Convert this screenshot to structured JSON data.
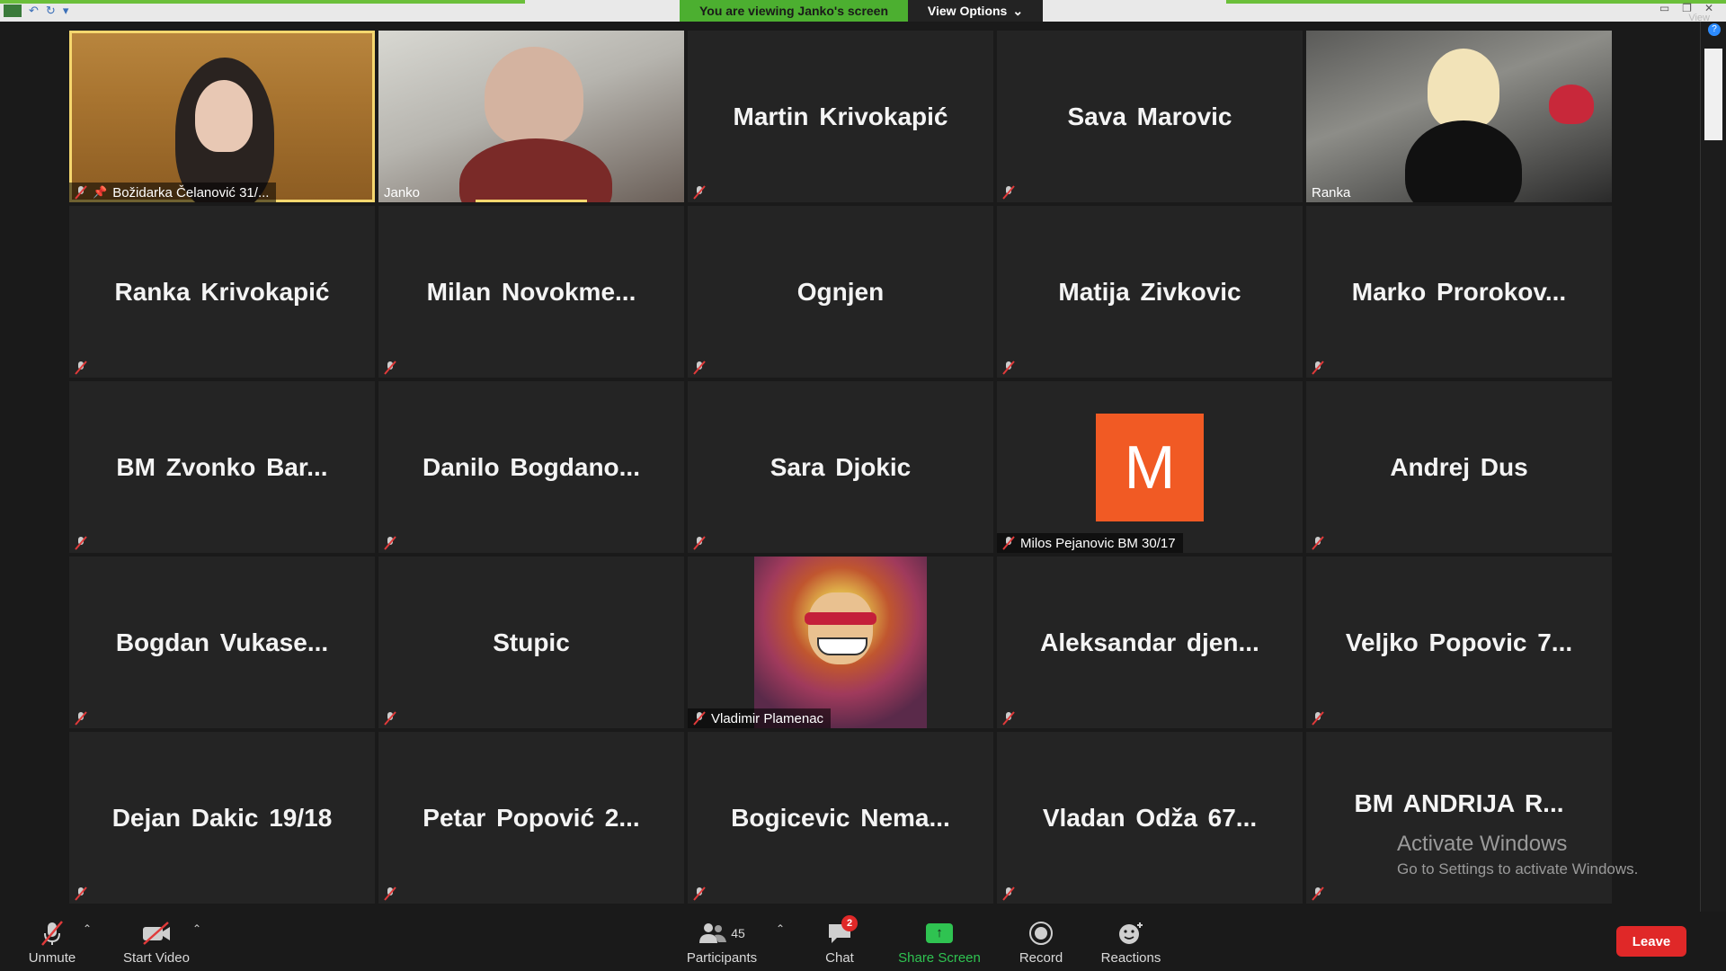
{
  "banner": {
    "viewing_text": "You are viewing Janko's screen",
    "view_options_label": "View Options",
    "view_label": "View"
  },
  "tiles": [
    {
      "name": "Božidarka Čelanović 31/...",
      "footer": "Božidarka Čelanović 31/...",
      "video": true
    },
    {
      "name": "Janko",
      "footer": "Janko",
      "video": true
    },
    {
      "name": "Martin Krivokapić"
    },
    {
      "name": "Sava Marovic"
    },
    {
      "name": "Ranka",
      "footer": "Ranka",
      "video": true
    },
    {
      "name": "Ranka Krivokapić"
    },
    {
      "name": "Milan Novokme..."
    },
    {
      "name": "Ognjen"
    },
    {
      "name": "Matija Zivkovic"
    },
    {
      "name": "Marko Prorokov..."
    },
    {
      "name": "BM Zvonko Bar..."
    },
    {
      "name": "Danilo Bogdano..."
    },
    {
      "name": "Sara Djokic"
    },
    {
      "name": "Milos Pejanovic BM 30/17",
      "footer": "Milos Pejanovic BM 30/17",
      "avatar_letter": "M"
    },
    {
      "name": "Andrej Dus"
    },
    {
      "name": "Bogdan Vukase..."
    },
    {
      "name": "Stupic"
    },
    {
      "name": "Vladimir Plamenac",
      "footer": "Vladimir Plamenac"
    },
    {
      "name": "Aleksandar djen..."
    },
    {
      "name": "Veljko Popovic 7..."
    },
    {
      "name": "Dejan Dakic 19/18"
    },
    {
      "name": "Petar Popović 2..."
    },
    {
      "name": "Bogicevic Nema..."
    },
    {
      "name": "Vladan Odža 67..."
    },
    {
      "name": "BM ANDRIJA R..."
    }
  ],
  "watermark": {
    "line1": "Activate Windows",
    "line2": "Go to Settings to activate Windows."
  },
  "toolbar": {
    "unmute_label": "Unmute",
    "start_video_label": "Start Video",
    "participants_label": "Participants",
    "participants_count": "45",
    "chat_label": "Chat",
    "chat_badge": "2",
    "share_label": "Share Screen",
    "record_label": "Record",
    "reactions_label": "Reactions",
    "leave_label": "Leave"
  },
  "colors": {
    "accent_green": "#4caf30",
    "leave_red": "#e02828",
    "avatar_orange": "#f15a24",
    "pinned_border": "#f5d76e"
  }
}
